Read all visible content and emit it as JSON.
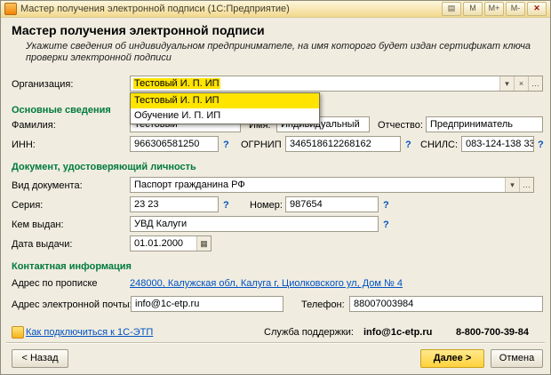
{
  "colors": {
    "titlebar_top": "#fdf6dd",
    "titlebar_bottom": "#f3d98e",
    "section_title": "#007a3d",
    "link": "#0052c2",
    "selection": "#ffe400",
    "primary_button": "#ffd23b"
  },
  "window": {
    "title": "Мастер получения электронной подписи  (1С:Предприятие)",
    "controls": {
      "dock": "▤",
      "scale": "M",
      "scale_plus": "M+",
      "scale_minus": "M-",
      "close": "✕"
    }
  },
  "header": {
    "title": "Мастер получения электронной подписи",
    "hint": "Укажите сведения об индивидуальном предпринимателе, на имя которого будет издан сертификат ключа проверки электронной подписи"
  },
  "icons": {
    "dropdown": "▾",
    "clear": "×",
    "choose": "…",
    "calendar": "▦"
  },
  "misc": {
    "help": "?"
  },
  "organization": {
    "label": "Организация:",
    "value": "Тестовый И. П. ИП",
    "dropdown": [
      "Тестовый И. П. ИП",
      "Обучение И. П. ИП"
    ]
  },
  "sections": {
    "main": {
      "title": "Основные сведения",
      "lastname_label": "Фамилия:",
      "lastname": "Тестовый",
      "firstname_label": "Имя:",
      "firstname": "Индивидуальный",
      "middlename_label": "Отчество:",
      "middlename": "Предприниматель",
      "inn_label": "ИНН:",
      "inn": "966306581250",
      "ogrnip_label": "ОГРНИП",
      "ogrnip": "346518612268162",
      "snils_label": "СНИЛС:",
      "snils": "083-124-138 33"
    },
    "doc": {
      "title": "Документ, удостоверяющий личность",
      "kind_label": "Вид документа:",
      "kind": "Паспорт гражданина РФ",
      "series_label": "Серия:",
      "series": "23 23",
      "number_label": "Номер:",
      "number": "987654",
      "issued_by_label": "Кем выдан:",
      "issued_by": "УВД Калуги",
      "issue_date_label": "Дата выдачи:",
      "issue_date": "01.01.2000"
    },
    "contact": {
      "title": "Контактная информация",
      "address_label": "Адрес по прописке",
      "address": "248000, Калужская обл, Калуга г, Циолковского ул, Дом № 4",
      "email_label": "Адрес электронной почты:",
      "email": "info@1c-etp.ru",
      "phone_label": "Телефон:",
      "phone": "88007003984"
    }
  },
  "footer": {
    "link": "Как подключиться к 1С-ЭТП",
    "support_label": "Служба поддержки:",
    "support_email": "info@1c-etp.ru",
    "support_phone": "8-800-700-39-84",
    "back": "< Назад",
    "next": "Далее >",
    "cancel": "Отмена"
  }
}
